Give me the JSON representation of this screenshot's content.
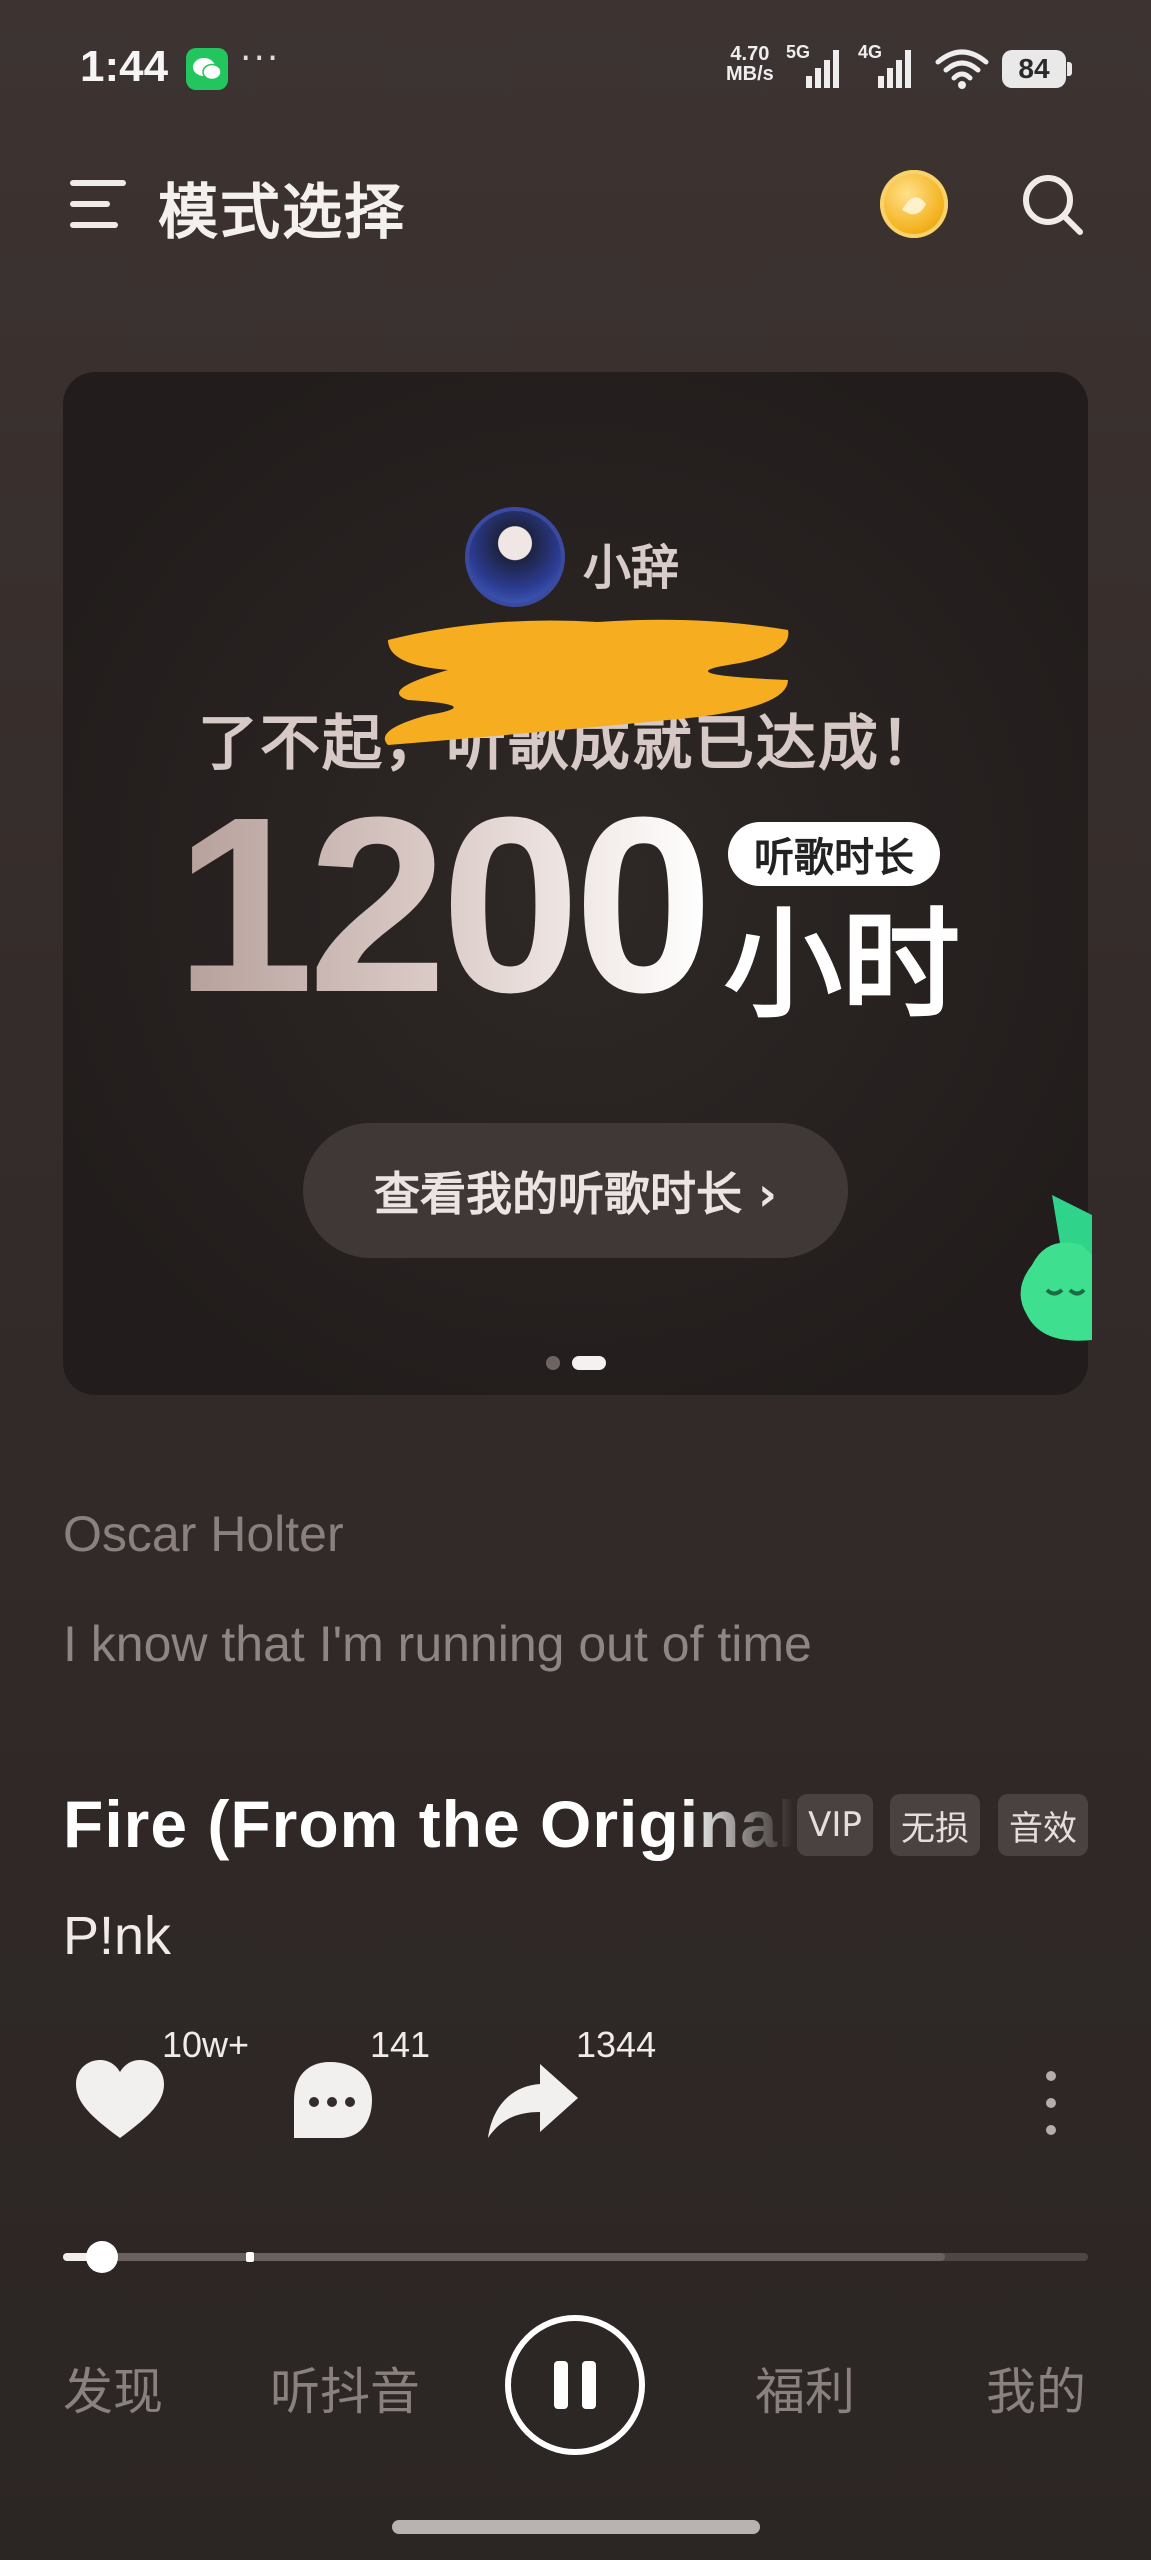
{
  "status_bar": {
    "time": "1:44",
    "dots": "···",
    "net_speed_value": "4.70",
    "net_speed_unit": "MB/s",
    "network_1": "5G",
    "network_2": "4G",
    "battery": "84"
  },
  "header": {
    "title": "模式选择"
  },
  "card": {
    "username": "小辞",
    "achievement": "了不起，听歌成就已达成！",
    "number": "1200",
    "badge": "听歌时长",
    "unit": "小时",
    "button_label": "查看我的听歌时长 ›"
  },
  "lyrics": {
    "artist": "Oscar Holter",
    "line": "I know that I'm running out of time"
  },
  "song": {
    "title": "Fire (From the Original",
    "artist": "P!nk",
    "tags": [
      "VIP",
      "无损",
      "音效"
    ]
  },
  "actions": {
    "likes": "10w+",
    "comments": "141",
    "shares": "1344"
  },
  "progress": {
    "played_fraction": 0.04,
    "buffered_fraction": 0.86
  },
  "nav": {
    "items": [
      "发现",
      "听抖音",
      "福利",
      "我的"
    ]
  },
  "colors": {
    "background": "#342c2a",
    "card": "#221d1c",
    "accent_coin": "#f4b321"
  }
}
